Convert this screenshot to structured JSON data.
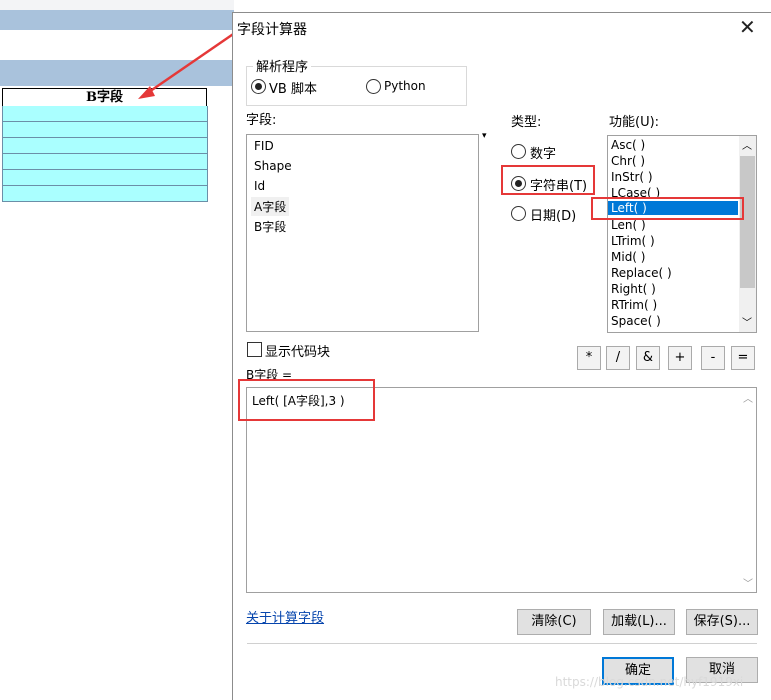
{
  "background_table": {
    "column_header": "B字段",
    "row_count": 6
  },
  "dialog": {
    "title": "字段计算器",
    "parser_group": {
      "title": "解析程序",
      "options": [
        {
          "label": "VB 脚本",
          "selected": true
        },
        {
          "label": "Python",
          "selected": false
        }
      ]
    },
    "fields": {
      "label": "字段:",
      "items": [
        "FID",
        "Shape",
        "Id",
        "A字段",
        "B字段"
      ]
    },
    "type": {
      "label": "类型:",
      "options": [
        {
          "label": "数字",
          "selected": false
        },
        {
          "label": "字符串(T)",
          "selected": true
        },
        {
          "label": "日期(D)",
          "selected": false
        }
      ]
    },
    "functions": {
      "label": "功能(U):",
      "items": [
        "Asc( )",
        "Chr( )",
        "InStr( )",
        "LCase( )",
        "Left( )",
        "Len( )",
        "LTrim( )",
        "Mid( )",
        "Replace( )",
        "Right( )",
        "RTrim( )",
        "Space( )"
      ],
      "selected": "Left( )"
    },
    "show_codeblock": {
      "label": "显示代码块",
      "checked": false
    },
    "operators": [
      "*",
      "/",
      "&",
      "+",
      "-",
      "="
    ],
    "expression": {
      "label": "B字段 =",
      "value": "Left( [A字段],3 )"
    },
    "link": "关于计算字段",
    "buttons": {
      "clear": "清除(C)",
      "load": "加载(L)...",
      "save": "保存(S)...",
      "ok": "确定",
      "cancel": "取消"
    },
    "watermark": "https://blog.csdn.net/hyf1919xi"
  },
  "colors": {
    "accent": "#0078d7",
    "highlight_red": "#e53838",
    "cell_cyan": "#aaffff"
  }
}
